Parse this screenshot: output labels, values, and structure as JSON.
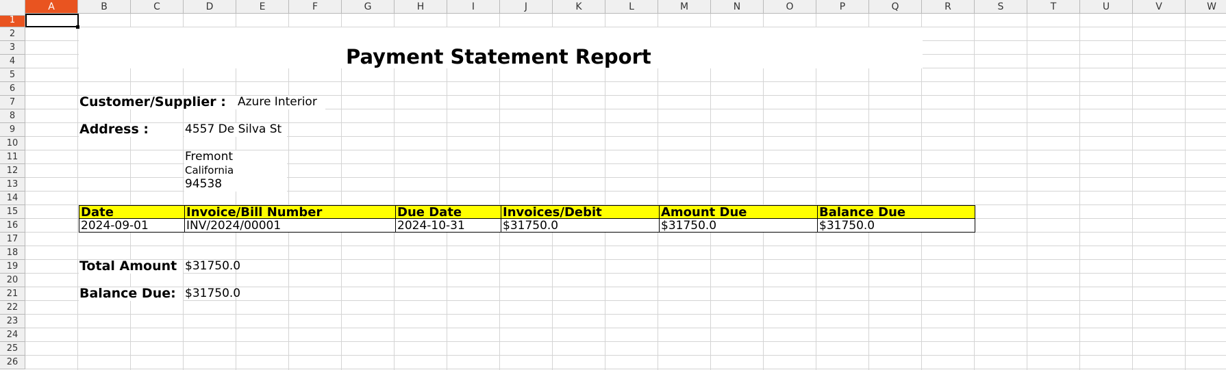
{
  "columns": [
    "A",
    "B",
    "C",
    "D",
    "E",
    "F",
    "G",
    "H",
    "I",
    "J",
    "K",
    "L",
    "M",
    "N",
    "O",
    "P",
    "Q",
    "R",
    "S",
    "T",
    "U",
    "V",
    "W"
  ],
  "rows": [
    "1",
    "2",
    "3",
    "4",
    "5",
    "6",
    "7",
    "8",
    "9",
    "10",
    "11",
    "12",
    "13",
    "14",
    "15",
    "16",
    "17",
    "18",
    "19",
    "20",
    "21",
    "22",
    "23",
    "24",
    "25",
    "26"
  ],
  "active_cell": "A1",
  "report": {
    "title": "Payment Statement Report",
    "customer_label": "Customer/Supplier :",
    "customer_value": "Azure Interior",
    "address_label": "Address :",
    "address_line1": "4557 De Silva St",
    "address_city": "Fremont",
    "address_state": "California",
    "address_zip": "94538"
  },
  "table": {
    "headers": [
      "Date",
      "Invoice/Bill Number",
      "Due Date",
      "Invoices/Debit",
      "Amount Due",
      "Balance Due"
    ],
    "rows": [
      [
        "2024-09-01",
        "INV/2024/00001",
        "2024-10-31",
        "$31750.0",
        "$31750.0",
        "$31750.0"
      ]
    ]
  },
  "summary": {
    "total_amount_label": "Total Amount",
    "total_amount_value": "$31750.0",
    "balance_due_label": "Balance Due:",
    "balance_due_value": "$31750.0"
  },
  "colors": {
    "header_highlight": "#ffff00",
    "active_header": "#e95420",
    "grid": "#d4d4d4"
  }
}
